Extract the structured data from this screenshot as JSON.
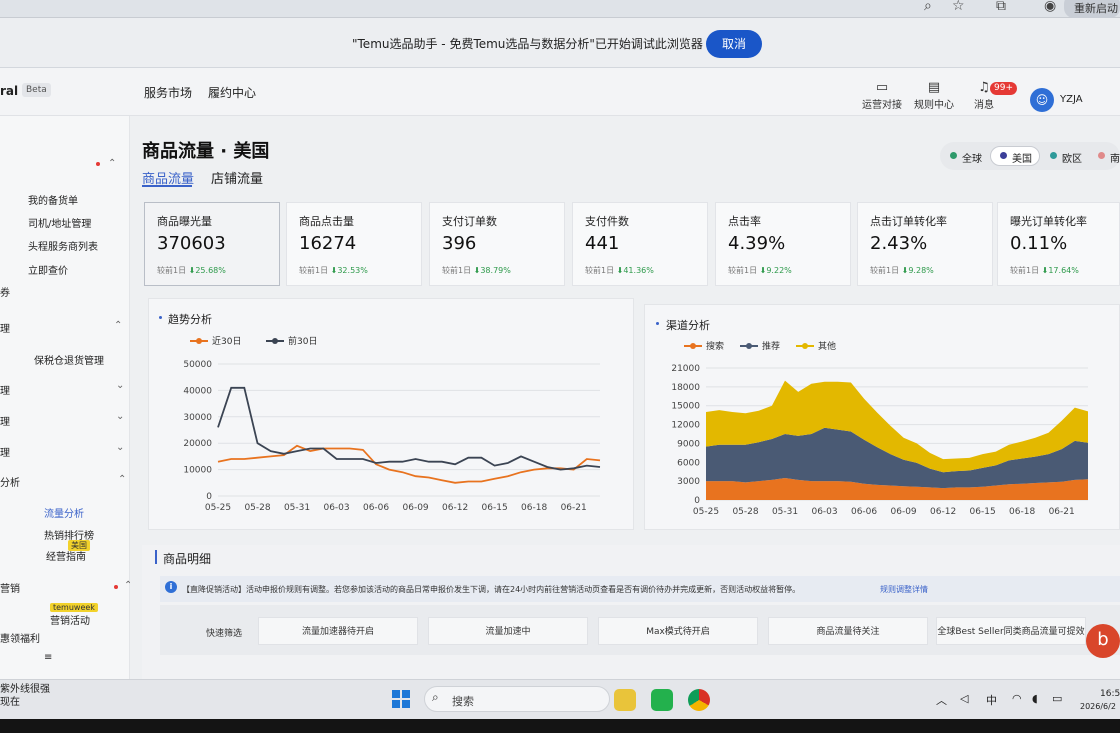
{
  "browser": {
    "restart_label": "重新启动"
  },
  "notification": {
    "message": "\"Temu选品助手 - 免费Temu选品与数据分析\"已开始调试此浏览器",
    "cancel_label": "取消"
  },
  "topnav": {
    "brand": "ral",
    "beta": "Beta",
    "links": [
      "服务市场",
      "履约中心"
    ],
    "tools": [
      "运营对接",
      "规则中心",
      "消息"
    ],
    "message_badge": "99+",
    "user": "YZJA"
  },
  "sidebar": {
    "items": [
      "我的备货单",
      "司机/地址管理",
      "头程服务商列表",
      "立即查价",
      "券",
      "理",
      "保税仓退货管理",
      "理",
      "理",
      "理",
      "分析",
      "流量分析",
      "热销排行榜",
      "经营指南",
      "营销",
      "营销活动",
      "惠领福利"
    ],
    "tags": {
      "guide": "美国",
      "marketing": "temuweek"
    }
  },
  "page": {
    "title": "商品流量 · 美国",
    "tabs": [
      "商品流量",
      "店铺流量"
    ],
    "regions": [
      "全球",
      "美国",
      "欧区",
      "南"
    ]
  },
  "metrics": [
    {
      "label": "商品曝光量",
      "value": "370603",
      "compare": "较前1日",
      "change": "25.68%"
    },
    {
      "label": "商品点击量",
      "value": "16274",
      "compare": "较前1日",
      "change": "32.53%"
    },
    {
      "label": "支付订单数",
      "value": "396",
      "compare": "较前1日",
      "change": "38.79%"
    },
    {
      "label": "支付件数",
      "value": "441",
      "compare": "较前1日",
      "change": "41.36%"
    },
    {
      "label": "点击率",
      "value": "4.39%",
      "compare": "较前1日",
      "change": "9.22%"
    },
    {
      "label": "点击订单转化率",
      "value": "2.43%",
      "compare": "较前1日",
      "change": "9.28%"
    },
    {
      "label": "曝光订单转化率",
      "value": "0.11%",
      "compare": "较前1日",
      "change": "17.64%"
    }
  ],
  "chart_data": [
    {
      "type": "line",
      "title": "趋势分析",
      "x": [
        "05-25",
        "05-26",
        "05-27",
        "05-28",
        "05-29",
        "05-30",
        "05-31",
        "06-01",
        "06-02",
        "06-03",
        "06-04",
        "06-05",
        "06-06",
        "06-07",
        "06-08",
        "06-09",
        "06-10",
        "06-11",
        "06-12",
        "06-13",
        "06-14",
        "06-15",
        "06-16",
        "06-17",
        "06-18",
        "06-19",
        "06-20",
        "06-21",
        "06-22",
        "06-23"
      ],
      "x_ticks": [
        "05-25",
        "05-28",
        "05-31",
        "06-03",
        "06-06",
        "06-09",
        "06-12",
        "06-15",
        "06-18",
        "06-21"
      ],
      "y_ticks": [
        0,
        10000,
        20000,
        30000,
        40000,
        50000
      ],
      "ylim": [
        0,
        50000
      ],
      "series": [
        {
          "name": "近30日",
          "color": "#e8731f",
          "values": [
            13000,
            14000,
            14000,
            14500,
            15000,
            15500,
            19000,
            17000,
            18000,
            18000,
            18000,
            17500,
            12000,
            10000,
            9000,
            7500,
            7000,
            6000,
            5000,
            5500,
            5500,
            6500,
            7500,
            9000,
            10000,
            10500,
            10500,
            10000,
            14000,
            13500
          ]
        },
        {
          "name": "前30日",
          "color": "#3b4453",
          "values": [
            26000,
            41000,
            41000,
            20000,
            17000,
            16000,
            17000,
            18000,
            18000,
            14000,
            14000,
            14000,
            12500,
            13000,
            13000,
            14000,
            13000,
            13000,
            12000,
            14500,
            14500,
            11500,
            12500,
            15000,
            13000,
            11000,
            10000,
            10500,
            11500,
            11000
          ]
        }
      ]
    },
    {
      "type": "area",
      "title": "渠道分析",
      "stacked": true,
      "x": [
        "05-25",
        "05-26",
        "05-27",
        "05-28",
        "05-29",
        "05-30",
        "05-31",
        "06-01",
        "06-02",
        "06-03",
        "06-04",
        "06-05",
        "06-06",
        "06-07",
        "06-08",
        "06-09",
        "06-10",
        "06-11",
        "06-12",
        "06-13",
        "06-14",
        "06-15",
        "06-16",
        "06-17",
        "06-18",
        "06-19",
        "06-20",
        "06-21",
        "06-22",
        "06-23"
      ],
      "x_ticks": [
        "05-25",
        "05-28",
        "05-31",
        "06-03",
        "06-06",
        "06-09",
        "06-12",
        "06-15",
        "06-18",
        "06-21"
      ],
      "y_ticks": [
        0,
        3000,
        6000,
        9000,
        12000,
        15000,
        18000,
        21000
      ],
      "ylim": [
        0,
        21000
      ],
      "series": [
        {
          "name": "搜索",
          "color": "#e8731f",
          "values": [
            3000,
            3000,
            3000,
            2800,
            3000,
            3200,
            3500,
            3200,
            3000,
            3000,
            3000,
            2900,
            2600,
            2400,
            2300,
            2200,
            2100,
            2000,
            1900,
            2000,
            2000,
            2100,
            2300,
            2500,
            2600,
            2700,
            2800,
            2900,
            3200,
            3300
          ]
        },
        {
          "name": "推荐",
          "color": "#4a5a74",
          "values": [
            5500,
            5800,
            5800,
            6000,
            6200,
            6500,
            7000,
            7000,
            7500,
            8500,
            8200,
            8000,
            7000,
            6000,
            5000,
            4200,
            3800,
            3000,
            2500,
            2600,
            2700,
            3000,
            3200,
            3800,
            4000,
            4200,
            4500,
            5200,
            6200,
            5800
          ]
        },
        {
          "name": "其他",
          "color": "#e3b800",
          "values": [
            5500,
            5500,
            5200,
            5000,
            5000,
            5300,
            8500,
            7000,
            8000,
            7300,
            7600,
            7800,
            6500,
            5500,
            4500,
            3500,
            3100,
            2500,
            2100,
            2000,
            2000,
            2200,
            2200,
            2500,
            2700,
            3000,
            3400,
            4500,
            5300,
            5000
          ]
        }
      ]
    }
  ],
  "detail": {
    "title": "商品明细",
    "notice": "【直降促销活动】活动申报价规则有调整。若您参加该活动的商品日常申报价发生下调，请在24小时内前往营销活动页查看是否有调价待办并完成更新，否则活动权益将暂停。",
    "notice_link": "规则调整详情",
    "filter_label": "快速筛选",
    "filters": [
      "流量加速器待开启",
      "流量加速中",
      "Max模式待开启",
      "商品流量待关注",
      "全球Best Seller同类商品流量可提效"
    ]
  },
  "taskbar": {
    "left_line1": "紫外线很强",
    "left_line2": "现在",
    "search": "搜索",
    "tray_lang": "中",
    "time": "16:5",
    "date": "2026/6/2"
  }
}
